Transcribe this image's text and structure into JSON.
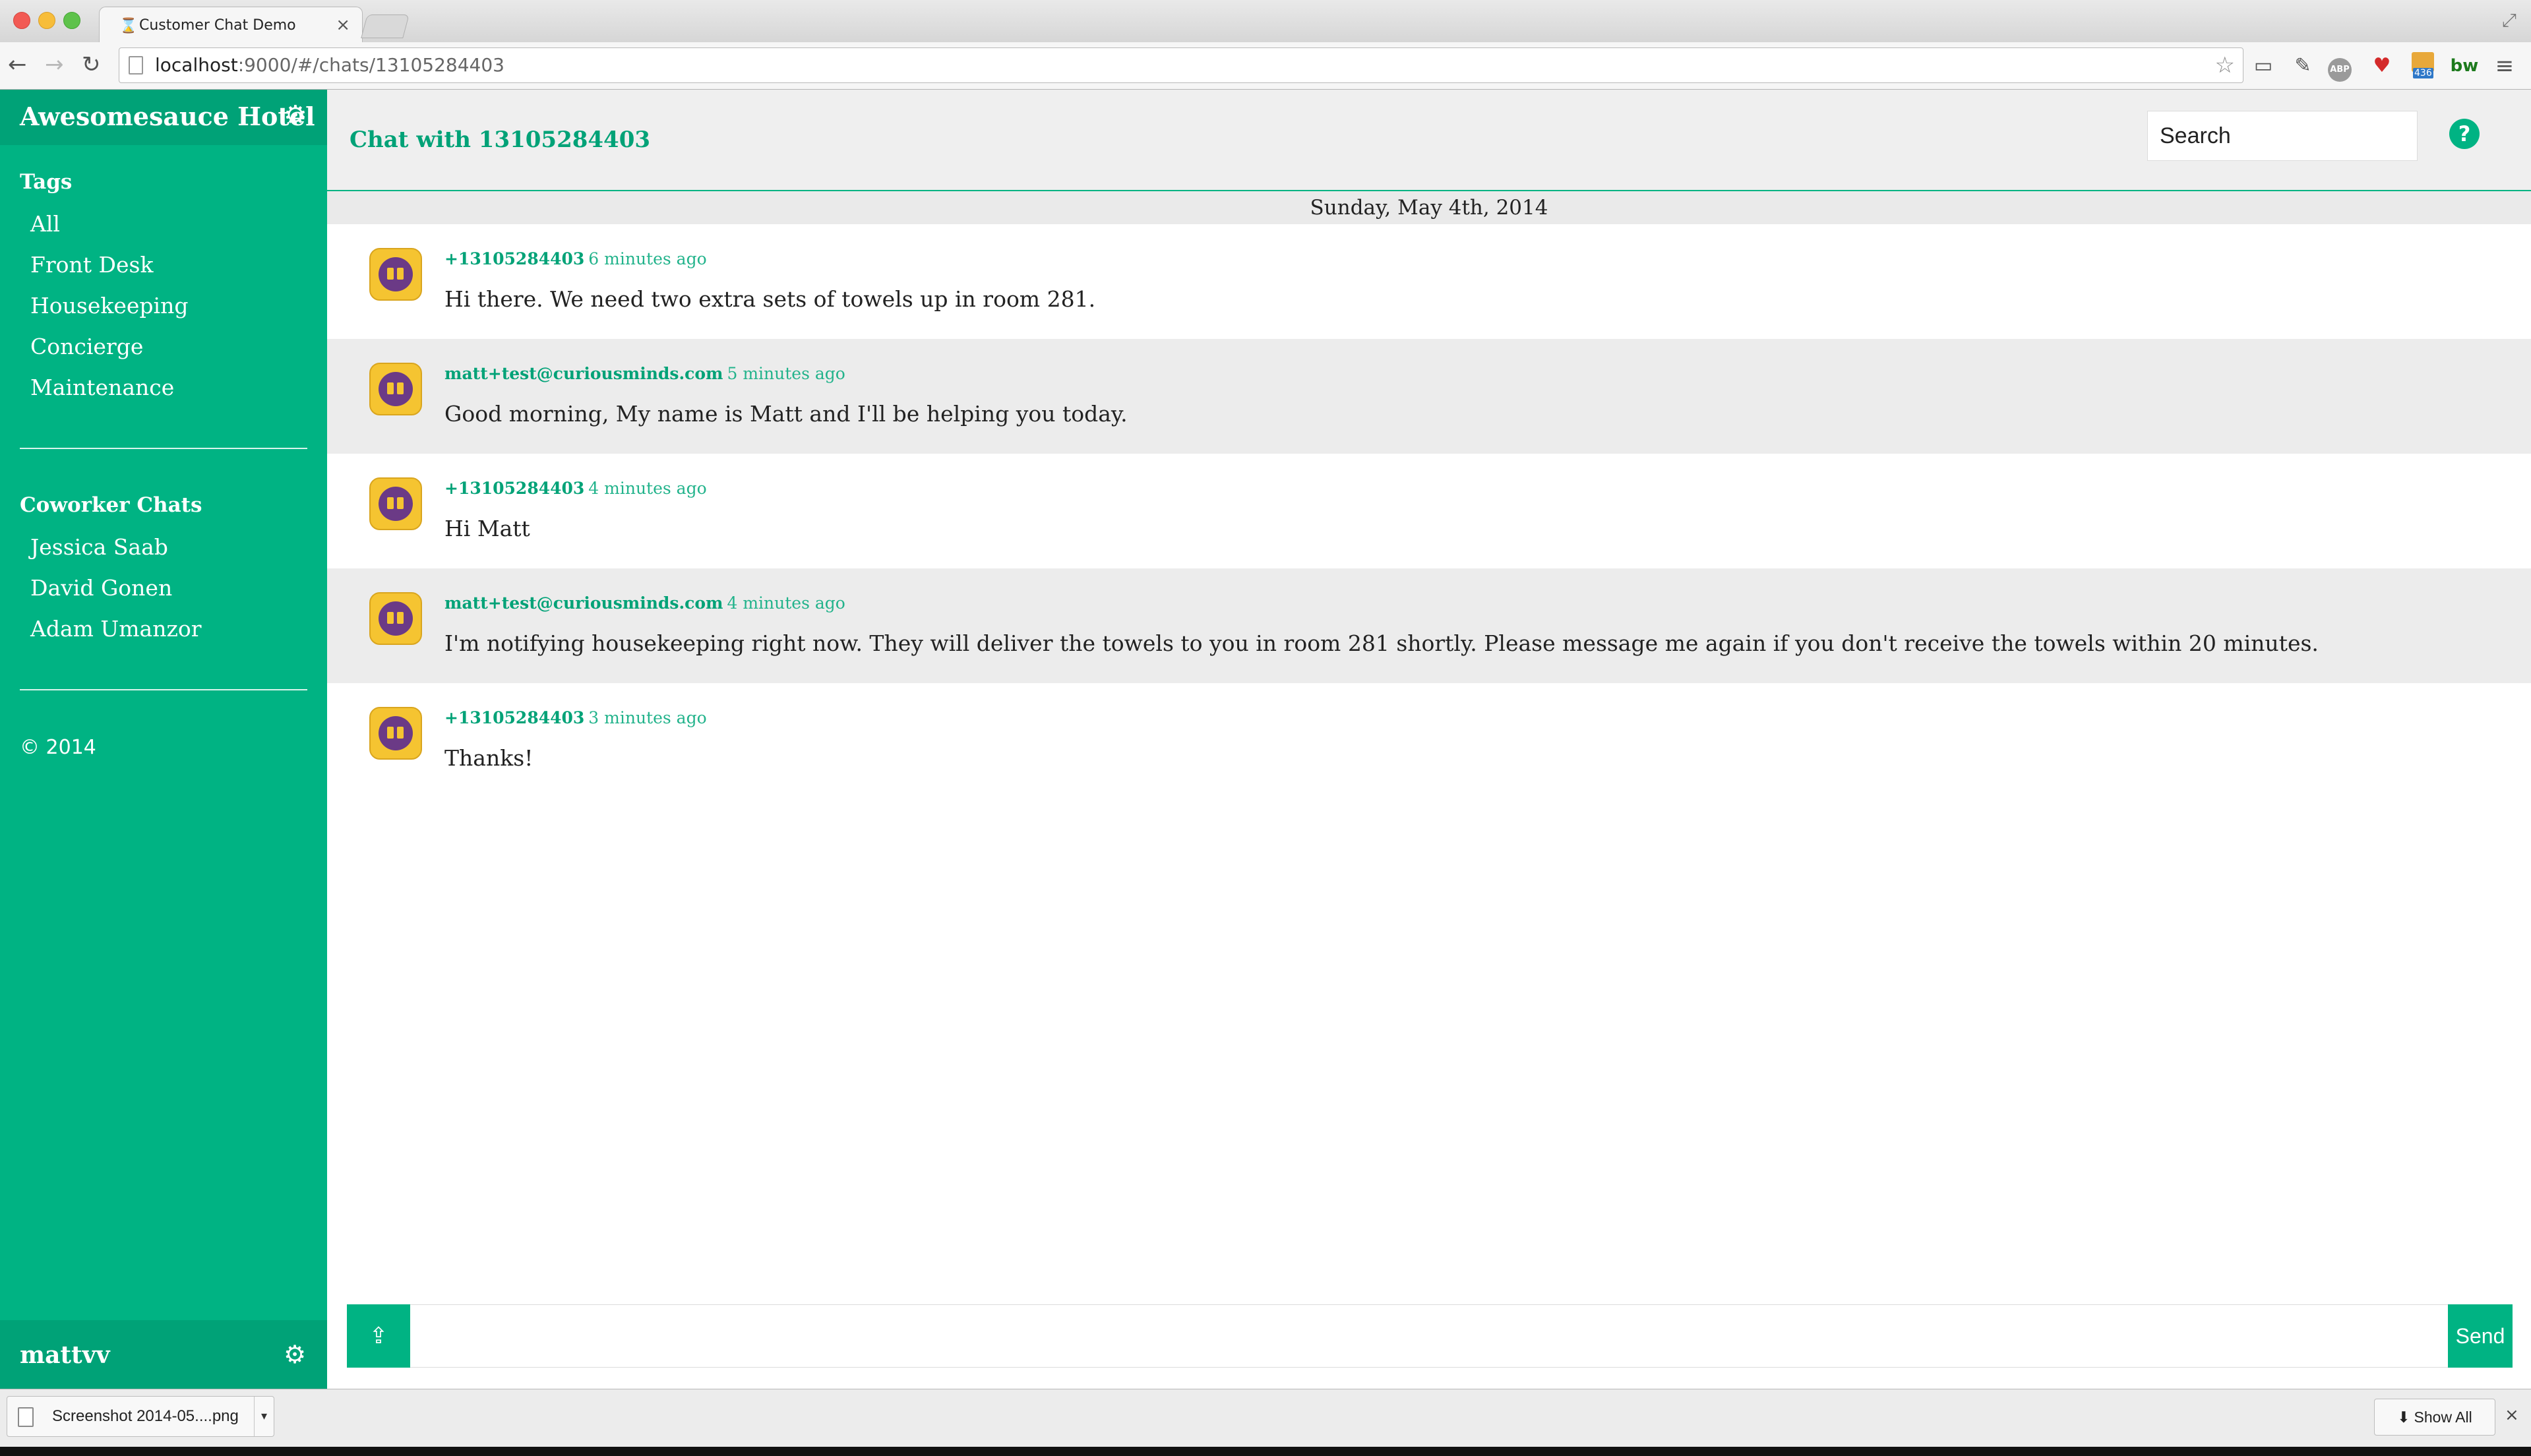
{
  "browser": {
    "tab_title": "Customer Chat Demo",
    "url_host": "localhost",
    "url_rest": ":9000/#/chats/13105284403",
    "extensions": [
      "cast-icon",
      "wrench-icon",
      "adblock-icon",
      "heart-icon",
      "gift-icon",
      "bw-icon",
      "menu-icon"
    ],
    "gift_badge": "436",
    "abp_label": "ABP",
    "bw_label": "bw"
  },
  "sidebar": {
    "brand": "Awesomesauce Hotel",
    "tags_heading": "Tags",
    "tags": [
      "All",
      "Front Desk",
      "Housekeeping",
      "Concierge",
      "Maintenance"
    ],
    "coworkers_heading": "Coworker Chats",
    "coworkers": [
      "Jessica Saab",
      "David Gonen",
      "Adam Umanzor"
    ],
    "copyright": "© 2014",
    "username": "mattvv"
  },
  "header": {
    "title": "Chat with 13105284403",
    "search_placeholder": "Search",
    "help_glyph": "?"
  },
  "date_label": "Sunday, May 4th, 2014",
  "messages": [
    {
      "author": "+13105284403",
      "time": "6 minutes ago",
      "text": "Hi there. We need two extra sets of towels up in room 281."
    },
    {
      "author": "matt+test@curiousminds.com",
      "time": "5 minutes ago",
      "text": "Good morning, My name is Matt and I'll be helping you today."
    },
    {
      "author": "+13105284403",
      "time": "4 minutes ago",
      "text": "Hi Matt"
    },
    {
      "author": "matt+test@curiousminds.com",
      "time": "4 minutes ago",
      "text": "I'm notifying housekeeping right now. They will deliver the towels to you in room 281 shortly. Please message me again if you don't receive the towels within 20 minutes."
    },
    {
      "author": "+13105284403",
      "time": "3 minutes ago",
      "text": "Thanks!"
    }
  ],
  "composer": {
    "send_label": "Send",
    "message_value": ""
  },
  "downloads": {
    "file_name": "Screenshot 2014-05....png",
    "show_all_label": "Show All"
  },
  "colors": {
    "accent": "#00b383",
    "accent_dark": "#00a277",
    "alt_row": "#ececec"
  }
}
